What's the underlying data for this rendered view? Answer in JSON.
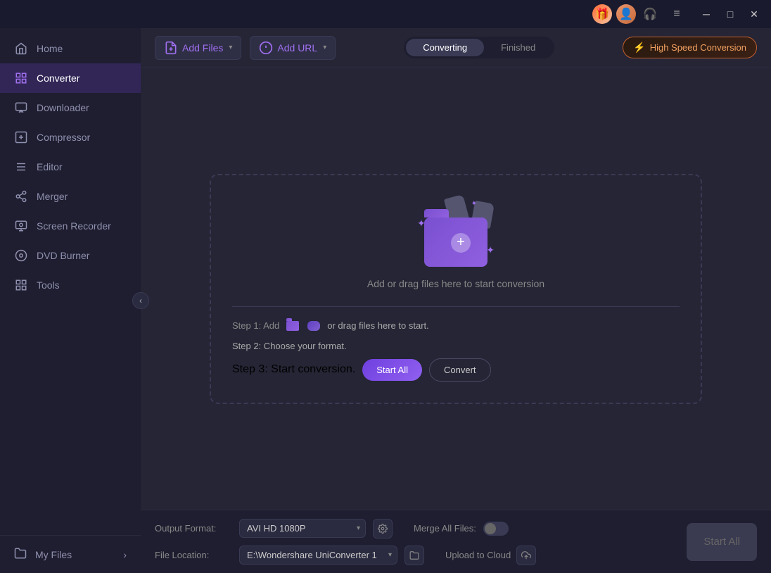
{
  "titlebar": {
    "menu_icon": "≡",
    "minimize": "─",
    "maximize": "□",
    "close": "✕"
  },
  "sidebar": {
    "collapse_label": "‹",
    "items": [
      {
        "id": "home",
        "label": "Home",
        "icon": "🏠"
      },
      {
        "id": "converter",
        "label": "Converter",
        "icon": "⟲",
        "active": true
      },
      {
        "id": "downloader",
        "label": "Downloader",
        "icon": "⬇"
      },
      {
        "id": "compressor",
        "label": "Compressor",
        "icon": "⊡"
      },
      {
        "id": "editor",
        "label": "Editor",
        "icon": "✂"
      },
      {
        "id": "merger",
        "label": "Merger",
        "icon": "⊞"
      },
      {
        "id": "screen-recorder",
        "label": "Screen Recorder",
        "icon": "⊙"
      },
      {
        "id": "dvd-burner",
        "label": "DVD Burner",
        "icon": "⊚"
      },
      {
        "id": "tools",
        "label": "Tools",
        "icon": "⊟"
      }
    ],
    "bottom_item": {
      "label": "My Files",
      "icon": "📁",
      "arrow": "›"
    }
  },
  "topbar": {
    "add_file_label": "Add Files",
    "add_url_label": "Add URL",
    "tabs": [
      {
        "id": "converting",
        "label": "Converting",
        "active": true
      },
      {
        "id": "finished",
        "label": "Finished",
        "active": false
      }
    ],
    "high_speed_label": "High Speed Conversion"
  },
  "dropzone": {
    "instruction": "Add or drag files here to start conversion",
    "step1_prefix": "Step 1: Add",
    "step1_suffix": "or drag files here to start.",
    "step2": "Step 2: Choose your format.",
    "step3_prefix": "Step 3: Start conversion.",
    "start_all_label": "Start All",
    "convert_label": "Convert"
  },
  "bottombar": {
    "output_format_label": "Output Format:",
    "output_format_value": "AVI HD 1080P",
    "file_location_label": "File Location:",
    "file_location_value": "E:\\Wondershare UniConverter 1",
    "merge_all_label": "Merge All Files:",
    "upload_cloud_label": "Upload to Cloud",
    "start_all_label": "Start All"
  }
}
